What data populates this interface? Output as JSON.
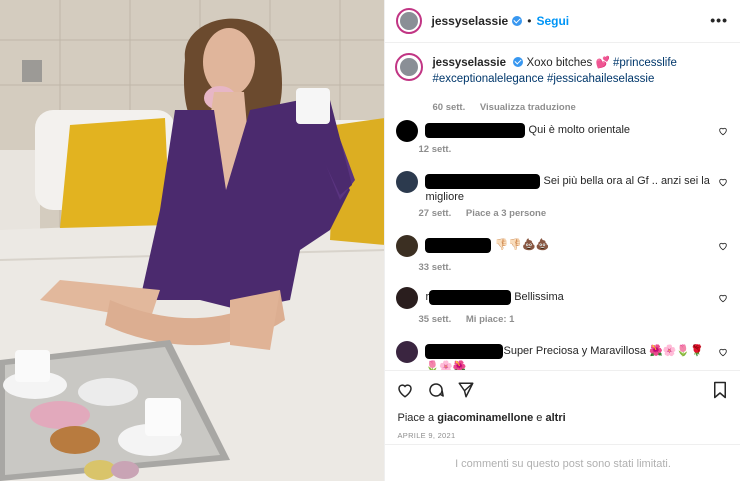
{
  "header": {
    "username": "jessyselassie",
    "separator": "•",
    "follow_label": "Segui",
    "more_icon": "more-icon"
  },
  "caption": {
    "username": "jessyselassie",
    "text": "Xoxo bitches 💕",
    "hashtags": [
      "#princesslife",
      "#exceptionalelegance",
      "#jessicahaileselassie"
    ],
    "age": "60 sett.",
    "translate_label": "Visualizza traduzione"
  },
  "comments": [
    {
      "text": "Qui è molto orientale",
      "age": "12 sett.",
      "extra": ""
    },
    {
      "text": "Sei più bella ora al Gf .. anzi sei la migliore",
      "age": "27 sett.",
      "extra": "Piace a 3 persone"
    },
    {
      "text": "👎🏻👎🏻💩💩",
      "age": "33 sett.",
      "extra": ""
    },
    {
      "text": "Bellissima",
      "prefix": "r",
      "age": "35 sett.",
      "extra": "Mi piace: 1"
    },
    {
      "text": "Super Preciosa y Maravillosa 🌺🌸🌷🌹🌷🌸🌺",
      "age": "",
      "extra": ""
    }
  ],
  "footer": {
    "likes_prefix": "Piace a",
    "likes_user": "giacominamellone",
    "likes_and": "e",
    "likes_others": "altri",
    "date": "APRILE 9, 2021",
    "comments_limited": "I commenti su questo post sono stati limitati."
  },
  "colors": {
    "accent": "#0095f6",
    "verified": "#3897f0",
    "hashtag": "#00376b",
    "robe": "#4b2a6e",
    "pillow": "#e2b320"
  }
}
